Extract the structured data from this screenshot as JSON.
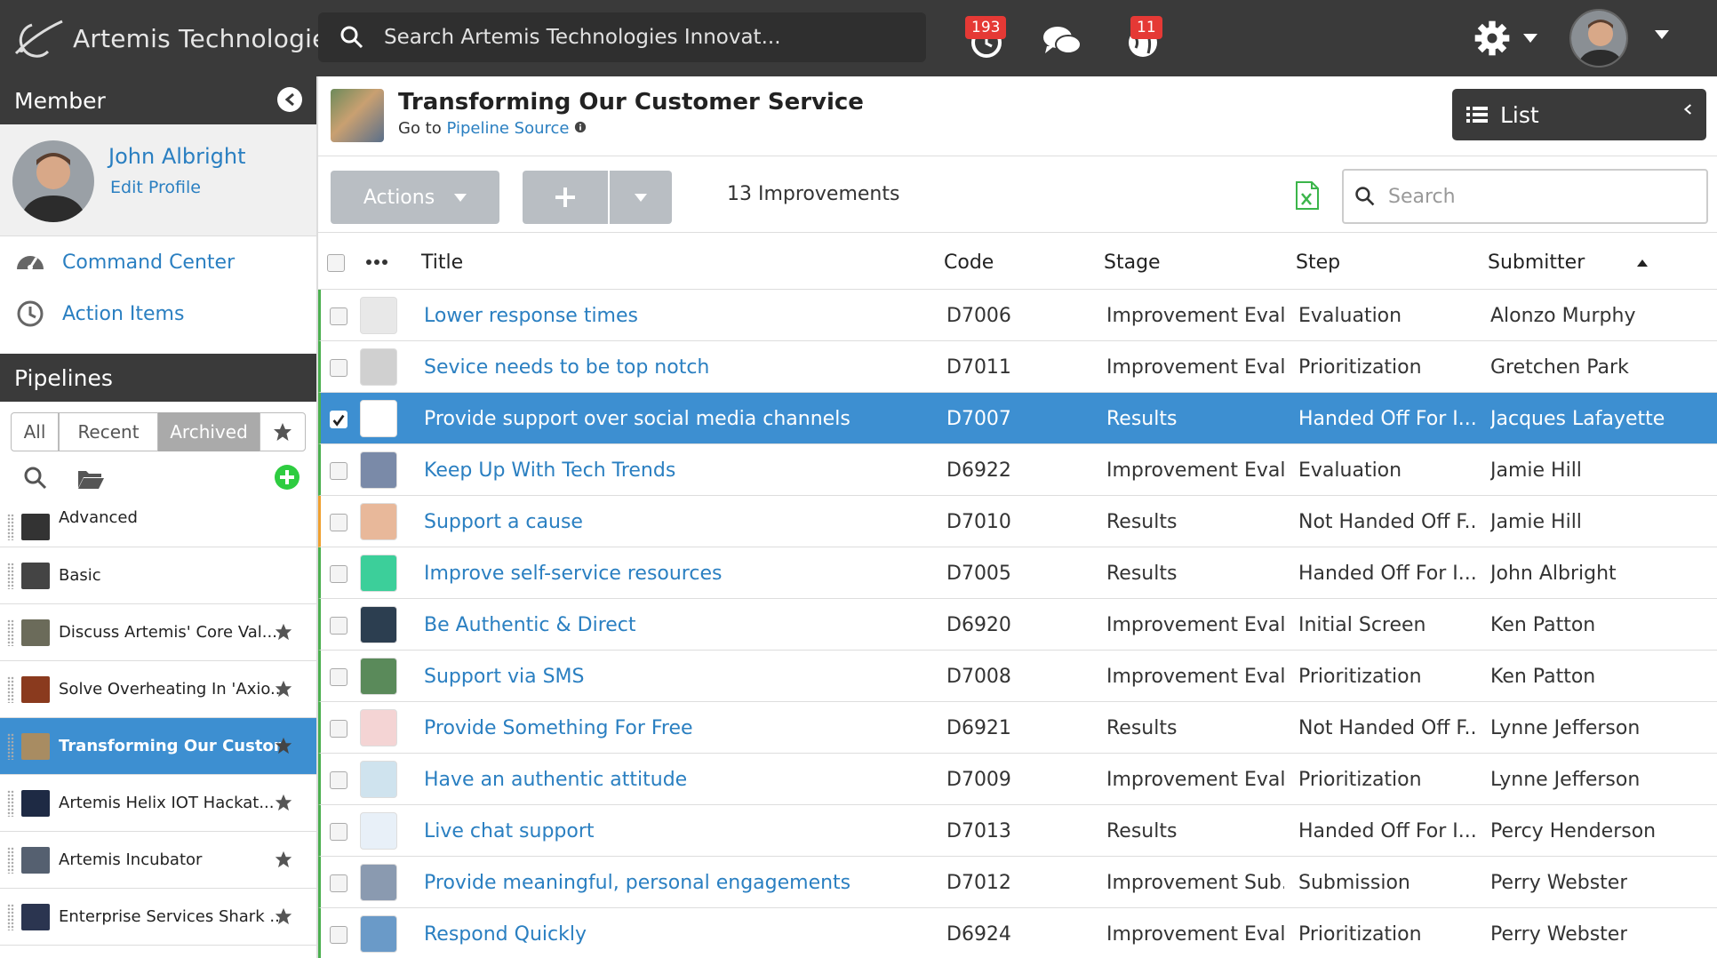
{
  "app": {
    "brand": "Artemis Technologies",
    "search_placeholder": "Search Artemis Technologies Innovat...",
    "notifications_count": "193",
    "alerts_count": "11"
  },
  "sidebar": {
    "member_header": "Member",
    "member_name": "John Albright",
    "edit_profile": "Edit Profile",
    "links": [
      {
        "label": "Command Center",
        "icon": "dashboard-icon"
      },
      {
        "label": "Action Items",
        "icon": "clock-icon"
      }
    ],
    "pipelines_header": "Pipelines",
    "filter_tabs": [
      "All",
      "Recent",
      "Archived"
    ],
    "active_filter": "Archived",
    "pipelines": [
      {
        "label": "Advanced",
        "thumb": "#333333",
        "star": false
      },
      {
        "label": "Basic",
        "thumb": "#444444",
        "star": false
      },
      {
        "label": "Discuss Artemis' Core Val...",
        "thumb": "#6b6b5a",
        "star": true
      },
      {
        "label": "Solve Overheating In 'Axio...",
        "thumb": "#8a3a1e",
        "star": true
      },
      {
        "label": "Transforming Our Custom...",
        "thumb": "#a88c62",
        "star": true,
        "active": true
      },
      {
        "label": "Artemis Helix IOT Hackat...",
        "thumb": "#1e2a44",
        "star": true
      },
      {
        "label": "Artemis Incubator",
        "thumb": "#556070",
        "star": true
      },
      {
        "label": "Enterprise Services Shark ...",
        "thumb": "#2b3550",
        "star": true
      }
    ]
  },
  "main": {
    "title": "Transforming Our Customer Service",
    "goto_prefix": "Go to",
    "goto_link": "Pipeline Source",
    "view_label": "List",
    "actions_label": "Actions",
    "count_label": "13 Improvements",
    "search_placeholder": "Search",
    "columns": {
      "title": "Title",
      "code": "Code",
      "stage": "Stage",
      "step": "Step",
      "submitter": "Submitter"
    },
    "rows": [
      {
        "title": "Lower response times",
        "code": "D7006",
        "stage": "Improvement Eval...",
        "step": "Evaluation",
        "submitter": "Alonzo Murphy",
        "thumb": "#e8e8e8",
        "edge": "#4caf50"
      },
      {
        "title": "Sevice needs to be top notch",
        "code": "D7011",
        "stage": "Improvement Eval...",
        "step": "Prioritization",
        "submitter": "Gretchen Park",
        "thumb": "#d0d0d0",
        "edge": "#4caf50"
      },
      {
        "title": "Provide support over social media channels",
        "code": "D7007",
        "stage": "Results",
        "step": "Handed Off For I...",
        "submitter": "Jacques Lafayette",
        "thumb": "#ffffff",
        "edge": "#4caf50",
        "selected": true
      },
      {
        "title": "Keep Up With Tech Trends",
        "code": "D6922",
        "stage": "Improvement Eval...",
        "step": "Evaluation",
        "submitter": "Jamie Hill",
        "thumb": "#7a8aa8",
        "edge": "#4caf50"
      },
      {
        "title": "Support a cause",
        "code": "D7010",
        "stage": "Results",
        "step": "Not Handed Off F...",
        "submitter": "Jamie Hill",
        "thumb": "#e8b89a",
        "edge": "#f0a030"
      },
      {
        "title": "Improve self-service resources",
        "code": "D7005",
        "stage": "Results",
        "step": "Handed Off For I...",
        "submitter": "John Albright",
        "thumb": "#3ccf9a",
        "edge": "#4caf50"
      },
      {
        "title": "Be Authentic & Direct",
        "code": "D6920",
        "stage": "Improvement Eval...",
        "step": "Initial Screen",
        "submitter": "Ken Patton",
        "thumb": "#2c3e50",
        "edge": "#4caf50"
      },
      {
        "title": "Support via SMS",
        "code": "D7008",
        "stage": "Improvement Eval...",
        "step": "Prioritization",
        "submitter": "Ken Patton",
        "thumb": "#5a8a5a",
        "edge": "#4caf50"
      },
      {
        "title": "Provide Something For Free",
        "code": "D6921",
        "stage": "Results",
        "step": "Not Handed Off F...",
        "submitter": "Lynne Jefferson",
        "thumb": "#f4d4d4",
        "edge": "#4caf50"
      },
      {
        "title": "Have an authentic attitude",
        "code": "D7009",
        "stage": "Improvement Eval...",
        "step": "Prioritization",
        "submitter": "Lynne Jefferson",
        "thumb": "#cfe3ee",
        "edge": "#4caf50"
      },
      {
        "title": "Live chat support",
        "code": "D7013",
        "stage": "Results",
        "step": "Handed Off For I...",
        "submitter": "Percy Henderson",
        "thumb": "#e8f0f8",
        "edge": "#4caf50"
      },
      {
        "title": "Provide meaningful, personal engagements",
        "code": "D7012",
        "stage": "Improvement Sub...",
        "step": "Submission",
        "submitter": "Perry Webster",
        "thumb": "#8a9ab0",
        "edge": "#4caf50"
      },
      {
        "title": "Respond Quickly",
        "code": "D6924",
        "stage": "Improvement Eval...",
        "step": "Prioritization",
        "submitter": "Perry Webster",
        "thumb": "#6a9ac8",
        "edge": "#4caf50"
      }
    ]
  },
  "colors": {
    "accent": "#2a7fc1",
    "selected_row": "#3d8fd1",
    "topbar": "#3a3a3a",
    "badge": "#e53935"
  }
}
